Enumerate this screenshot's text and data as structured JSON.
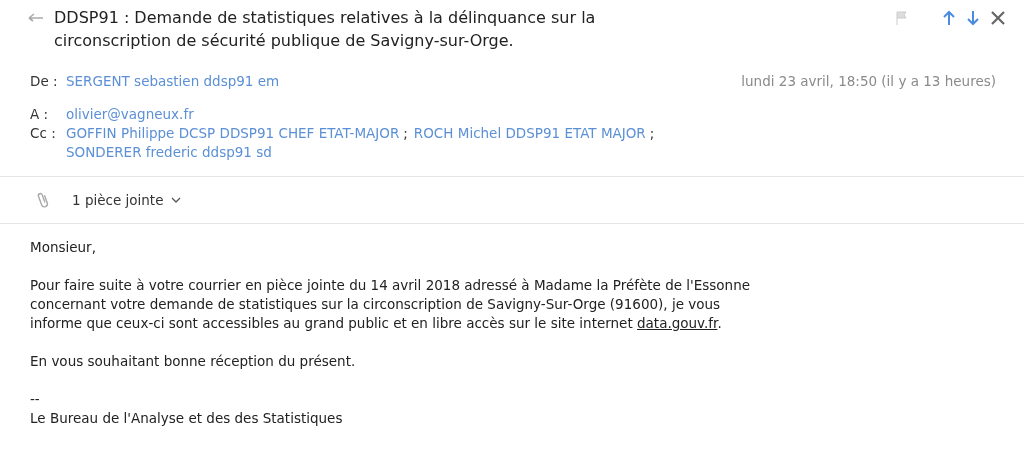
{
  "subject": "DDSP91 : Demande de statistiques relatives à la délinquance sur la circonscription de sécurité publique de Savigny-sur-Orge.",
  "toolbar": {
    "flagged": false
  },
  "from": {
    "label": "De :",
    "name": "SERGENT sebastien ddsp91 em"
  },
  "date": "lundi 23 avril, 18:50 (il y a 13 heures)",
  "to": {
    "label": "A :",
    "recipients": [
      {
        "name": "olivier@vagneux.fr"
      }
    ]
  },
  "cc": {
    "label": "Cc :",
    "recipients": [
      {
        "name": "GOFFIN Philippe DCSP DDSP91 CHEF ETAT-MAJOR",
        "sep": ";"
      },
      {
        "name": "ROCH Michel DDSP91 ETAT MAJOR",
        "sep": ";"
      },
      {
        "name": "SONDERER frederic ddsp91 sd"
      }
    ]
  },
  "attachments": {
    "label": "1 pièce jointe",
    "expanded": false
  },
  "body": [
    {
      "lines": [
        "Monsieur,"
      ]
    },
    {
      "lines": [
        "Pour faire suite à votre courrier en pièce jointe du 14 avril 2018 adressé à Madame la Préfète de l'Essonne",
        "concernant votre demande de statistiques sur la circonscription de Savigny-Sur-Orge (91600), je vous",
        "informe que ceux-ci sont accessibles au grand public et en libre accès sur le site internet "
      ],
      "link": "data.gouv.fr",
      "after": "."
    },
    {
      "lines": [
        "En vous souhaitant bonne réception du présent."
      ]
    },
    {
      "lines": [
        "--",
        "Le Bureau de l'Analyse et des des Statistiques"
      ]
    }
  ]
}
